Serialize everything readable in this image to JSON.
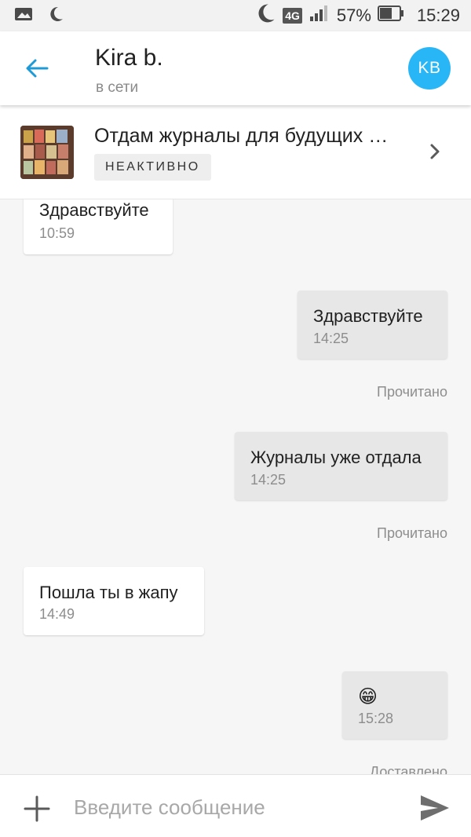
{
  "status_bar": {
    "battery": "57%",
    "network": "4G",
    "time": "15:29",
    "icons": [
      "image-icon",
      "moon-icon",
      "moon-icon",
      "signal-icon",
      "battery-icon"
    ]
  },
  "header": {
    "contact_name": "Kira b.",
    "contact_status": "в сети",
    "avatar_initials": "KB",
    "avatar_color": "#29b6f6",
    "accent_color": "#1e9bd7"
  },
  "listing": {
    "title": "Отдам журналы для будущих …",
    "status_badge": "НЕАКТИВНО"
  },
  "messages": [
    {
      "direction": "in",
      "text": "Здравствуйте",
      "time": "10:59"
    },
    {
      "direction": "out",
      "text": "Здравствуйте",
      "time": "14:25",
      "receipt": "Прочитано"
    },
    {
      "direction": "out",
      "text": "Журналы уже отдала",
      "time": "14:25",
      "receipt": "Прочитано"
    },
    {
      "direction": "in",
      "text": "Пошла ты в жапу",
      "time": "14:49"
    },
    {
      "direction": "out",
      "text": "😁",
      "time": "15:28",
      "receipt": "Доставлено"
    }
  ],
  "composer": {
    "placeholder": "Введите сообщение",
    "value": ""
  }
}
